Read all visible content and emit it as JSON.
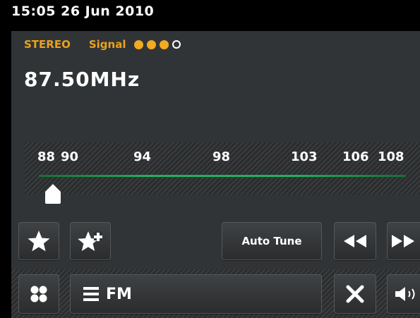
{
  "status_bar": {
    "clock": "15:05  26 Jun 2010"
  },
  "reception": {
    "mode": "STEREO",
    "signal_label": "Signal",
    "signal_level": 3,
    "signal_max": 4,
    "accent_color": "#f2aa20"
  },
  "frequency": "87.50MHz",
  "scale": {
    "labels": [
      "88",
      "90",
      "94",
      "98",
      "103",
      "106",
      "108"
    ],
    "band_color": "#23b05a"
  },
  "controls": {
    "favorite_icon": "star-icon",
    "add_favorite_icon": "star-plus-icon",
    "auto_tune_label": "Auto Tune",
    "rewind_icon": "rewind-icon",
    "forward_icon": "fast-forward-icon"
  },
  "bottom": {
    "menu_icon": "menu-dots-icon",
    "source_icon": "list-icon",
    "source_label": "FM",
    "close_icon": "close-icon",
    "volume_icon": "speaker-icon"
  }
}
